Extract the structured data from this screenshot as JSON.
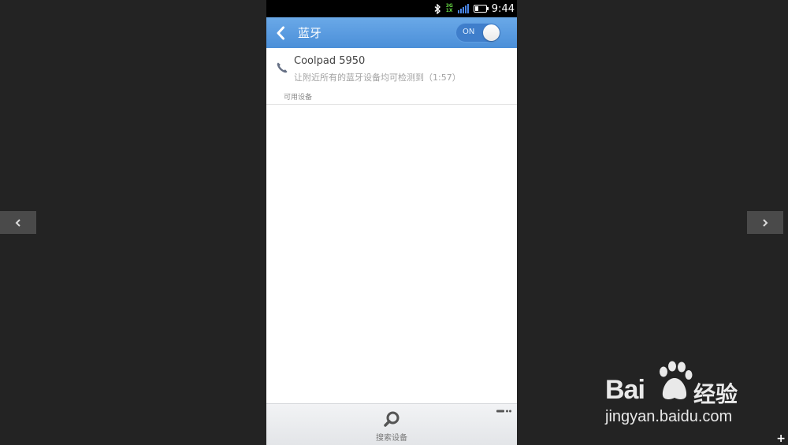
{
  "status_bar": {
    "time": "9:44",
    "network_top": "3G",
    "network_bottom": "1X"
  },
  "title_bar": {
    "title": "蓝牙",
    "toggle_label": "ON"
  },
  "device": {
    "name": "Coolpad 5950",
    "visibility": "让附近所有的蓝牙设备均可检测到（1:57）"
  },
  "available_section": {
    "header": "可用设备"
  },
  "bottom_bar": {
    "search_label": "搜索设备"
  },
  "watermark": {
    "brand_left": "Bai",
    "brand_right": "经验",
    "url": "jingyan.baidu.com"
  },
  "overlay": {
    "plus": "+"
  },
  "colors": {
    "accent": "#4b8fd8",
    "background": "#232323"
  },
  "icons": [
    "bluetooth-icon",
    "signal-icon",
    "battery-icon",
    "back-arrow-icon",
    "phone-icon",
    "search-icon",
    "more-icon",
    "chevron-left-icon",
    "chevron-right-icon"
  ]
}
